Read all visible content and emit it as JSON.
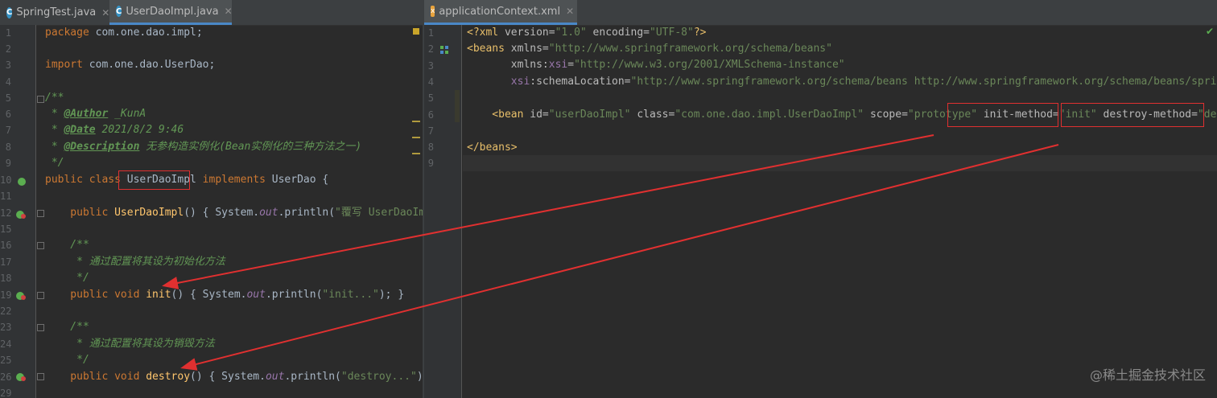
{
  "left_editor": {
    "tabs": [
      {
        "label": "SpringTest.java",
        "active": false
      },
      {
        "label": "UserDaoImpl.java",
        "active": true
      }
    ],
    "line_numbers": [
      "1",
      "2",
      "3",
      "4",
      "5",
      "6",
      "7",
      "8",
      "9",
      "10",
      "11",
      "12",
      "15",
      "16",
      "17",
      "18",
      "19",
      "22",
      "23",
      "24",
      "25",
      "26",
      "29"
    ],
    "code": {
      "l1_kw": "package",
      "l1_rest": " com.one.dao.impl;",
      "l3_kw": "import",
      "l3_rest": " com.one.dao.UserDao;",
      "l5": "/**",
      "l6_pre": " * ",
      "l6_tag": "@Author",
      "l6_val": " _KunA",
      "l7_pre": " * ",
      "l7_tag": "@Date",
      "l7_val": " 2021/8/2 9:46",
      "l8_pre": " * ",
      "l8_tag": "@Description",
      "l8_val": " 无参构造实例化(Bean实例化的三种方法之一)",
      "l9": " */",
      "l10_kw": "public class ",
      "l10_name": "UserDaoImpl",
      "l10_kw2": " implements ",
      "l10_rest": "UserDao {",
      "l12_kw": "    public ",
      "l12_fn": "UserDaoImpl",
      "l12_rest": "() { System.",
      "l12_out": "out",
      "l12_rest2": ".println(",
      "l12_str": "\"覆写 UserDaoImpl 无",
      "l16": "    /**",
      "l17": "     * 通过配置将其设为初始化方法",
      "l18": "     */",
      "l19_kw": "    public void ",
      "l19_fn": "init",
      "l19_rest": "() { System.",
      "l19_out": "out",
      "l19_rest2": ".println(",
      "l19_str": "\"init...\"",
      "l19_end": "); }",
      "l23": "    /**",
      "l24": "     * 通过配置将其设为销毁方法",
      "l25": "     */",
      "l26_kw": "    public void ",
      "l26_fn": "destroy",
      "l26_rest": "() { System.",
      "l26_out": "out",
      "l26_rest2": ".println(",
      "l26_str": "\"destroy...\"",
      "l26_end": "); }"
    }
  },
  "right_editor": {
    "tabs": [
      {
        "label": "applicationContext.xml",
        "active": true
      }
    ],
    "line_numbers": [
      "1",
      "2",
      "3",
      "4",
      "5",
      "6",
      "7",
      "8",
      "9"
    ],
    "code": {
      "x1_a": "<?xml ",
      "x1_b": "version=",
      "x1_c": "\"1.0\"",
      "x1_d": " encoding=",
      "x1_e": "\"UTF-8\"",
      "x1_f": "?>",
      "x2_tag": "<beans ",
      "x2_attr": "xmlns=",
      "x2_val": "\"http://www.springframework.org/schema/beans\"",
      "x3_attr": "       xmlns:",
      "x3_ns": "xsi",
      "x3_eq": "=",
      "x3_val": "\"http://www.w3.org/2001/XMLSchema-instance\"",
      "x4_ns": "       xsi",
      "x4_attr": ":schemaLocation=",
      "x4_val": "\"http://www.springframework.org/schema/beans http://www.springframework.org/schema/beans/spring-beans.xsd\"",
      "x6_tag": "    <bean ",
      "x6_a1": "id=",
      "x6_v1": "\"userDaoImpl\"",
      "x6_a2": " class=",
      "x6_v2": "\"com.one.dao.impl.UserDaoImpl\"",
      "x6_a3": " scope=",
      "x6_v3": "\"prototype\"",
      "x6_a4": " init-method=",
      "x6_v4": "\"init\"",
      "x6_a5": " destroy-method=",
      "x6_v5": "\"destroy\"",
      "x6_end": "/>",
      "x8_tag": "</beans>"
    }
  },
  "watermark": "@稀土掘金技术社区",
  "colors": {
    "annotation": "#e03030",
    "background": "#2b2b2b",
    "keyword": "#cc7832",
    "string": "#6a8759"
  }
}
